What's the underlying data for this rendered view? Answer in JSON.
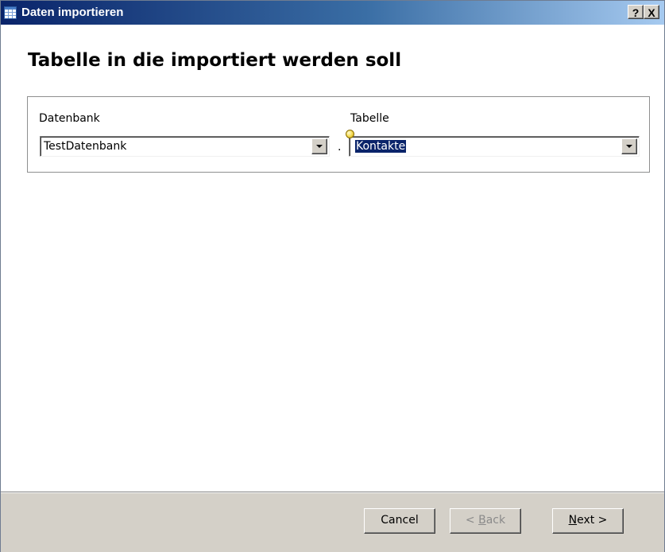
{
  "window": {
    "title": "Daten importieren",
    "help_label": "?",
    "close_label": "X"
  },
  "page": {
    "heading": "Tabelle in die importiert werden soll"
  },
  "form": {
    "database_label": "Datenbank",
    "database_value": "TestDatenbank",
    "separator": ".",
    "table_label": "Tabelle",
    "table_value": "Kontakte"
  },
  "buttons": {
    "cancel": "Cancel",
    "back_prefix": "< ",
    "back_accel": "B",
    "back_rest": "ack",
    "next_accel": "N",
    "next_rest": "ext >"
  },
  "colors": {
    "title_bar_start": "#0a246a",
    "title_bar_end": "#a6caf0",
    "selection": "#0a246a",
    "button_face": "#d4d0c8"
  },
  "icons": {
    "title": "table-icon",
    "dropdown": "chevron-down-icon",
    "pin": "pushpin-icon"
  }
}
